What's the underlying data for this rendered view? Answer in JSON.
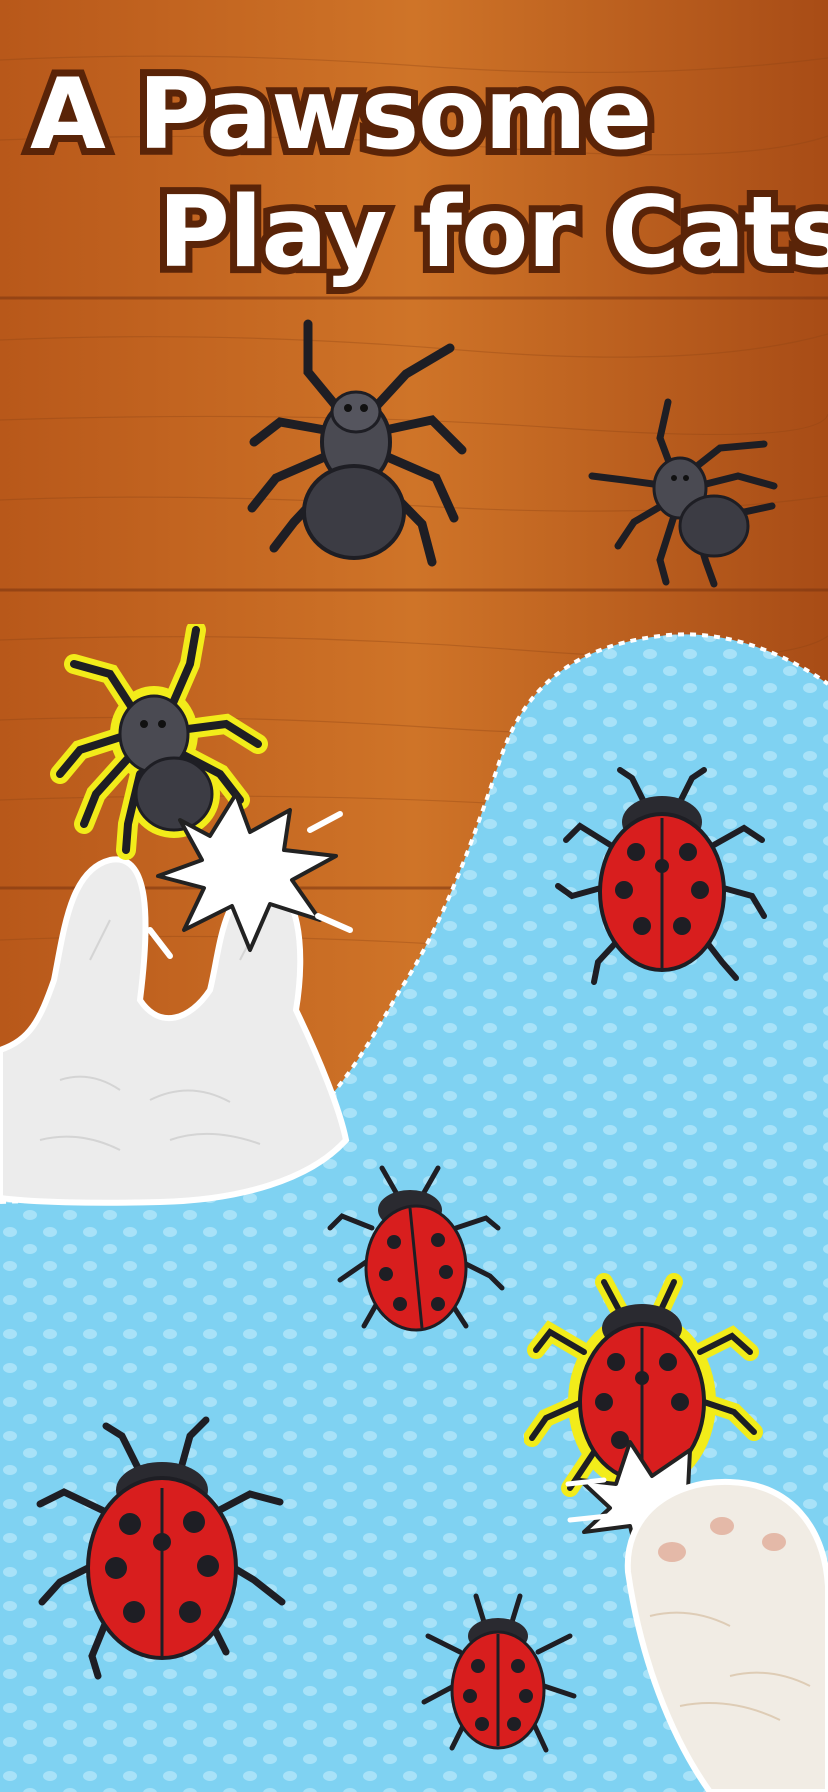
{
  "screen": {
    "headline_line1": "A Pawsome",
    "headline_line2": "Play for Cats"
  },
  "colors": {
    "wood_light": "#c86a24",
    "wood_dark": "#8a3e12",
    "sky_blue": "#7fd2f2",
    "dot_blue": "#a8e2f8",
    "ladybug_red": "#d81e1e",
    "spider_grey": "#3c3c44",
    "highlight_yellow": "#f2ec1a",
    "headline_outline": "#5a2408"
  },
  "creatures": [
    {
      "kind": "spider",
      "name": "spider-top-left",
      "highlighted": false
    },
    {
      "kind": "spider",
      "name": "spider-top-right",
      "highlighted": false
    },
    {
      "kind": "spider",
      "name": "spider-caught",
      "highlighted": true
    },
    {
      "kind": "ladybug",
      "name": "ladybug-upper-right",
      "highlighted": false
    },
    {
      "kind": "ladybug",
      "name": "ladybug-middle",
      "highlighted": false
    },
    {
      "kind": "ladybug",
      "name": "ladybug-caught",
      "highlighted": true
    },
    {
      "kind": "ladybug",
      "name": "ladybug-lower-left",
      "highlighted": false
    },
    {
      "kind": "ladybug",
      "name": "ladybug-bottom",
      "highlighted": false
    }
  ]
}
